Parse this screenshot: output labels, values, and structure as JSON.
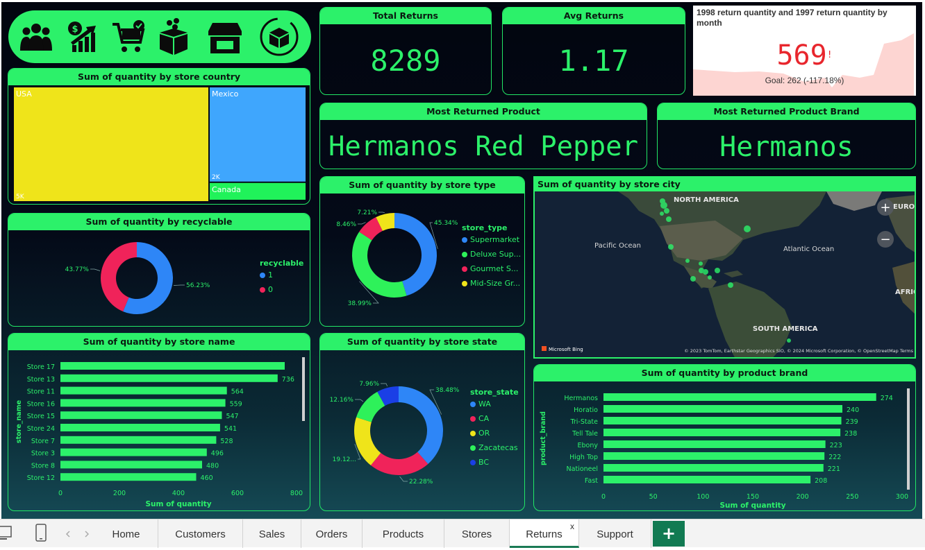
{
  "nav_icons": [
    "people-icon",
    "money-growth-icon",
    "cart-icon",
    "boxes-icon",
    "store-icon",
    "return-box-icon"
  ],
  "kpis": {
    "total_returns": {
      "label": "Total Returns",
      "value": "8289"
    },
    "avg_returns": {
      "label": "Avg Returns",
      "value": "1.17"
    },
    "most_returned_product": {
      "label": "Most Returned Product",
      "value": "Hermanos Red Pepper"
    },
    "most_returned_brand": {
      "label": "Most Returned Product Brand",
      "value": "Hermanos"
    }
  },
  "comparison_card": {
    "title": "1998 return quantity and 1997 return quantity by month",
    "value": "569",
    "alert": "!",
    "goal": "Goal: 262 (-117.18%)",
    "colors": {
      "value": "#e8262d",
      "area": "#fdd5d2"
    }
  },
  "treemap": {
    "title": "Sum of quantity by store country",
    "chart_data": {
      "type": "treemap",
      "items": [
        {
          "name": "USA",
          "label": "5K",
          "value": 5000,
          "color": "#efe41a"
        },
        {
          "name": "Mexico",
          "label": "2K",
          "value": 2100,
          "color": "#3fa6fd"
        },
        {
          "name": "Canada",
          "label": "",
          "value": 400,
          "color": "#20f25a"
        }
      ]
    }
  },
  "recyclable": {
    "title": "Sum of quantity by recyclable",
    "legend_title": "recyclable",
    "chart_data": {
      "type": "pie",
      "donut": true,
      "slices": [
        {
          "name": "1",
          "label": "56.23%",
          "value": 56.23,
          "color": "#2e86f7"
        },
        {
          "name": "0",
          "label": "43.77%",
          "value": 43.77,
          "color": "#f0235a"
        }
      ]
    }
  },
  "store_type": {
    "title": "Sum of quantity by store type",
    "legend_title": "store_type",
    "chart_data": {
      "type": "pie",
      "donut": true,
      "slices": [
        {
          "name": "Supermarket",
          "label": "45.34%",
          "value": 45.34,
          "color": "#2e86f7"
        },
        {
          "name": "Deluxe Sup...",
          "label": "38.99%",
          "value": 38.99,
          "color": "#2ef15a"
        },
        {
          "name": "Gourmet S...",
          "label": "8.46%",
          "value": 8.46,
          "color": "#f0235a"
        },
        {
          "name": "Mid-Size Gr...",
          "label": "7.21%",
          "value": 7.21,
          "color": "#efe41a"
        }
      ]
    }
  },
  "store_state": {
    "title": "Sum of quantity by store state",
    "legend_title": "store_state",
    "chart_data": {
      "type": "pie",
      "donut": true,
      "slices": [
        {
          "name": "WA",
          "label": "38.48%",
          "value": 38.48,
          "color": "#2e86f7"
        },
        {
          "name": "CA",
          "label": "22.28%",
          "value": 22.28,
          "color": "#f0235a"
        },
        {
          "name": "OR",
          "label": "19.12...",
          "value": 19.12,
          "color": "#efe41a"
        },
        {
          "name": "Zacatecas",
          "label": "12.16%",
          "value": 12.16,
          "color": "#2ef15a"
        },
        {
          "name": "BC",
          "label": "7.96%",
          "value": 7.96,
          "color": "#1a3fe6"
        }
      ]
    }
  },
  "map": {
    "title": "Sum of quantity by store city",
    "labels": {
      "north_america": "NORTH AMERICA",
      "south_america": "SOUTH AMERICA",
      "pacific": "Pacific Ocean",
      "atlantic": "Atlantic Ocean",
      "europe": "EUROPE",
      "africa": "AFRICA"
    },
    "attribution": "© 2023 TomTom, Earthstar Geographics SIO, © 2024 Microsoft Corporation, © OpenStreetMap  Terms",
    "brand": "Microsoft Bing",
    "zoom_in": "+",
    "zoom_out": "−"
  },
  "store_name": {
    "title": "Sum of quantity by store name",
    "chart_data": {
      "type": "bar",
      "orientation": "horizontal",
      "categories": [
        "Store 17",
        "Store 13",
        "Store 11",
        "Store 16",
        "Store 15",
        "Store 24",
        "Store 7",
        "Store 3",
        "Store 8",
        "Store 12"
      ],
      "values": [
        760,
        736,
        564,
        559,
        547,
        541,
        528,
        496,
        480,
        460
      ],
      "labels": [
        "",
        "736",
        "564",
        "559",
        "547",
        "541",
        "528",
        "496",
        "480",
        "460"
      ],
      "xlabel": "Sum of quantity",
      "ylabel": "store_name",
      "xlim": [
        0,
        800
      ],
      "xticks": [
        "0",
        "200",
        "400",
        "600",
        "800"
      ],
      "color": "#2cf16a"
    }
  },
  "product_brand": {
    "title": "Sum of quantity by product brand",
    "chart_data": {
      "type": "bar",
      "orientation": "horizontal",
      "categories": [
        "Hermanos",
        "Horatio",
        "Tri-State",
        "Tell Tale",
        "Ebony",
        "High Top",
        "Nationeel",
        "Fast"
      ],
      "values": [
        274,
        240,
        239,
        238,
        223,
        222,
        221,
        208
      ],
      "labels": [
        "274",
        "240",
        "239",
        "238",
        "223",
        "222",
        "221",
        "208"
      ],
      "xlabel": "Sum of quantity",
      "ylabel": "product_brand",
      "xlim": [
        0,
        300
      ],
      "xticks": [
        "0",
        "50",
        "100",
        "150",
        "200",
        "250",
        "300"
      ],
      "color": "#2cf16a"
    }
  },
  "tabs": {
    "items": [
      "Home",
      "Customers",
      "Sales",
      "Orders",
      "Products",
      "Stores",
      "Returns",
      "Support"
    ],
    "active": "Returns",
    "close": "x",
    "add": "+"
  }
}
